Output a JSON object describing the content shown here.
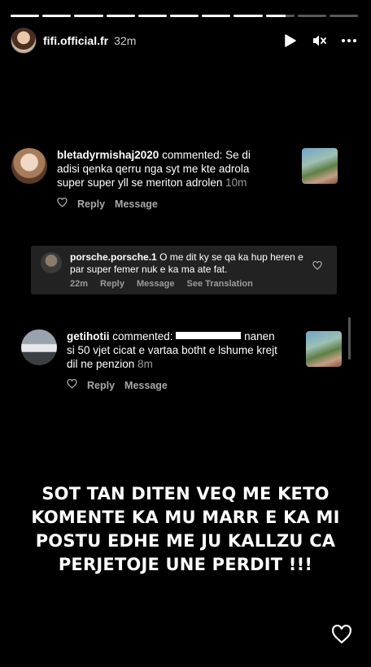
{
  "story": {
    "progress_segments": [
      1,
      1,
      1,
      1,
      1,
      1,
      1,
      1,
      0.7,
      0,
      0
    ],
    "username": "fifi.official.fr",
    "time": "32m",
    "icons": [
      "play-icon",
      "mute-icon",
      "more-icon"
    ]
  },
  "comments": [
    {
      "username": "bletadyrmishaj2020",
      "verb": " commented: ",
      "text": "Se di adisi qenka qerru nga syt me kte adrola super super yll se meriton adrolen",
      "time": "10m",
      "reply": "Reply",
      "message": "Message"
    },
    {
      "username": "porsche.porsche.1",
      "text": "O me dit ky se qa ka hup heren e par super femer nuk e ka ma ate fat.",
      "time": "22m",
      "reply": "Reply",
      "message": "Message",
      "translate": "See Translation"
    },
    {
      "username": "getihotii",
      "verb": " commented: ",
      "text_after_redaction": "nanen si 50 vjet cicat e vartaa botht e lshume krejt dil ne penzion",
      "time": "8m",
      "reply": "Reply",
      "message": "Message"
    }
  ],
  "caption": [
    "SOT TAN DITEN VEQ ME KETO",
    "KOMENTE KA MU MARR E KA MI",
    "POSTU EDHE ME JU KALLZU CA",
    "PERJETOJE UNE PERDIT !!!"
  ],
  "colors": {
    "background": "#000000",
    "muted_text": "#a8a8a8",
    "reply_box": "#222222"
  }
}
